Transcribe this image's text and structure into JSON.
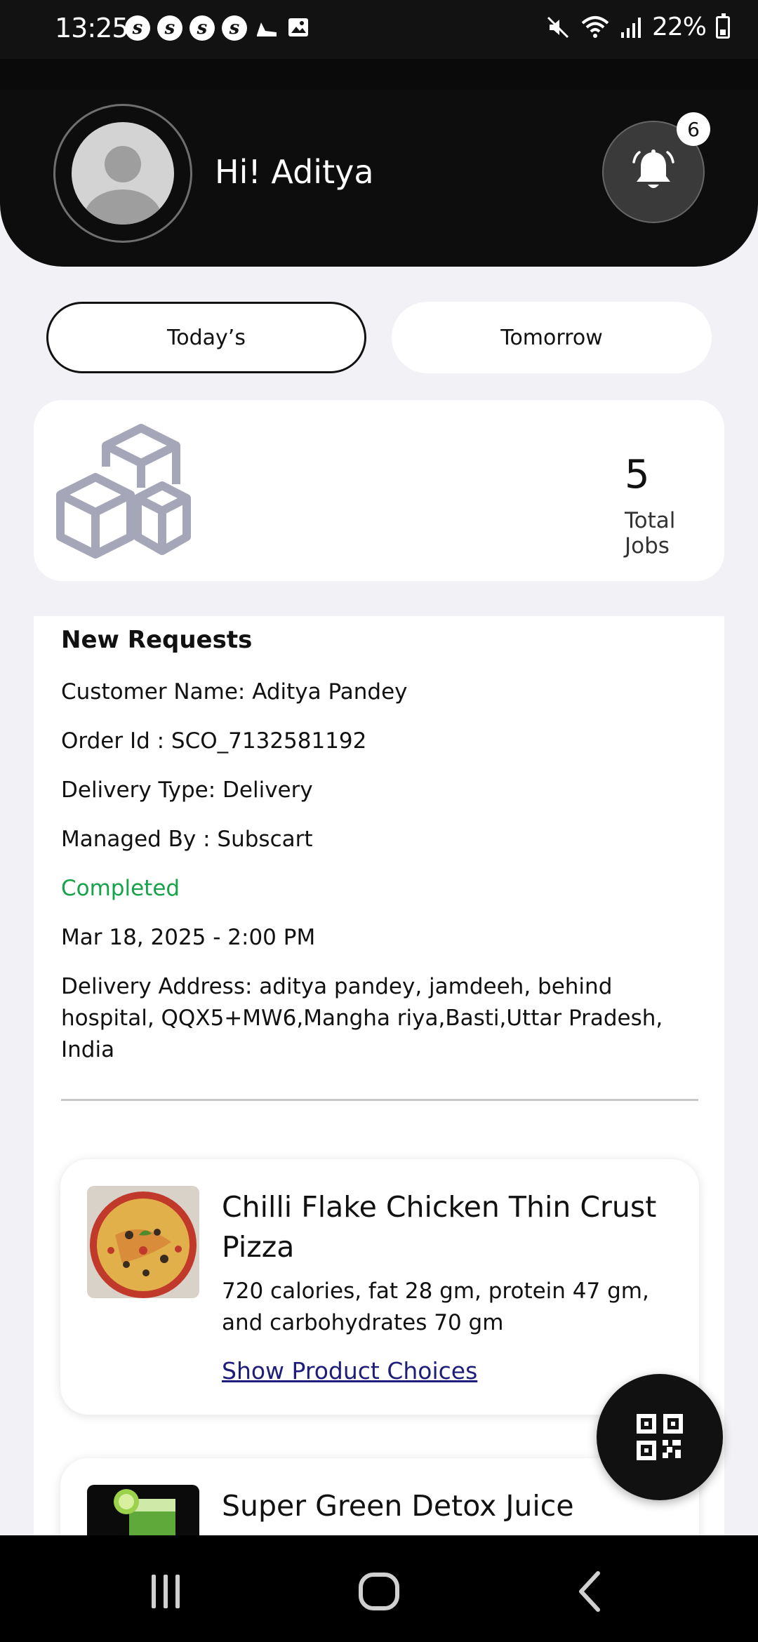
{
  "status_bar": {
    "time": "13:25",
    "app_icons": [
      "s",
      "s",
      "s",
      "s"
    ],
    "battery": "22%"
  },
  "header": {
    "greeting": "Hi! Aditya",
    "notification_count": "6"
  },
  "tabs": {
    "today": "Today’s",
    "tomorrow": "Tomorrow",
    "active": "today"
  },
  "summary": {
    "total_jobs": "5",
    "total_jobs_label": "Total Jobs"
  },
  "request": {
    "section_title": "New Requests",
    "customer": "Customer Name: Aditya Pandey",
    "order_id": "Order Id : SCO_7132581192",
    "delivery_type": "Delivery Type: Delivery",
    "managed_by": "Managed By : Subscart",
    "status": "Completed",
    "datetime": "Mar 18, 2025 - 2:00 PM",
    "address": "Delivery Address: aditya pandey, jamdeeh, behind hospital, QQX5+MW6,Mangha riya,Basti,Uttar Pradesh, India"
  },
  "products": [
    {
      "title": "Chilli Flake Chicken Thin Crust Pizza",
      "description": "720 calories, fat 28 gm, protein 47 gm, and carbohydrates 70 gm",
      "link_label": "Show Product Choices"
    },
    {
      "title": "Super Green Detox Juice"
    }
  ],
  "colors": {
    "header_bg": "#0d0d0d",
    "page_bg": "#f1f1f6",
    "status_completed": "#16a34a",
    "link": "#1e1e7a"
  },
  "icons": {
    "notification": "bell-icon",
    "jobs": "boxes-icon",
    "fab": "qr-scan-icon",
    "nav": [
      "recents-icon",
      "home-icon",
      "back-icon"
    ]
  }
}
